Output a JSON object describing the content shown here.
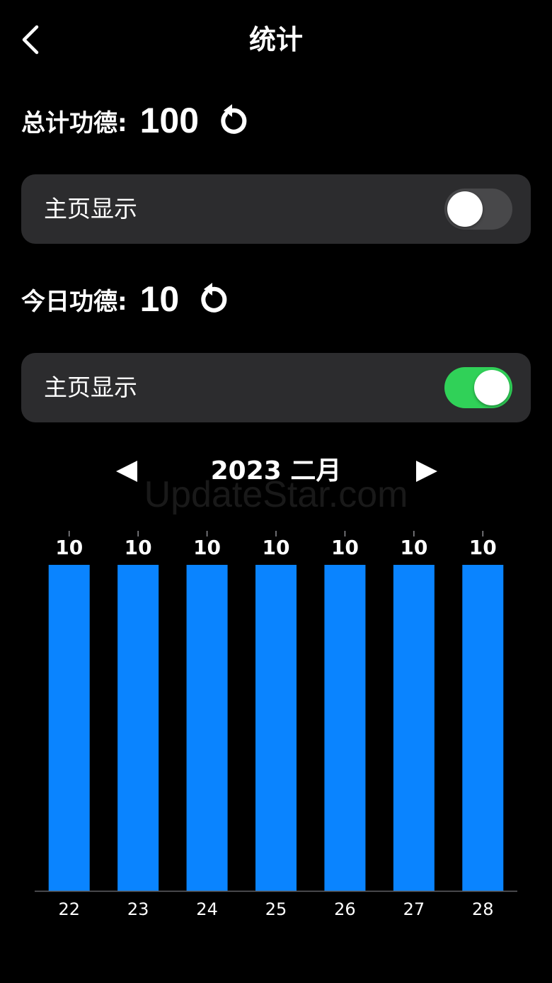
{
  "header": {
    "title": "统计"
  },
  "total": {
    "label": "总计功德:",
    "value": "100",
    "toggle": {
      "label": "主页显示",
      "on": false
    }
  },
  "today": {
    "label": "今日功德:",
    "value": "10",
    "toggle": {
      "label": "主页显示",
      "on": true
    }
  },
  "month_nav": {
    "title": "2023 二月"
  },
  "watermark": "UpdateStar.com",
  "colors": {
    "bar": "#0a84ff",
    "toggle_on": "#30d158",
    "toggle_off": "#48484a",
    "card": "#2c2c2e"
  },
  "chart_data": {
    "type": "bar",
    "categories": [
      "22",
      "23",
      "24",
      "25",
      "26",
      "27",
      "28"
    ],
    "values": [
      10,
      10,
      10,
      10,
      10,
      10,
      10
    ],
    "title": "",
    "xlabel": "",
    "ylabel": "",
    "ylim": [
      0,
      10
    ],
    "data_labels": true,
    "grid": false
  }
}
